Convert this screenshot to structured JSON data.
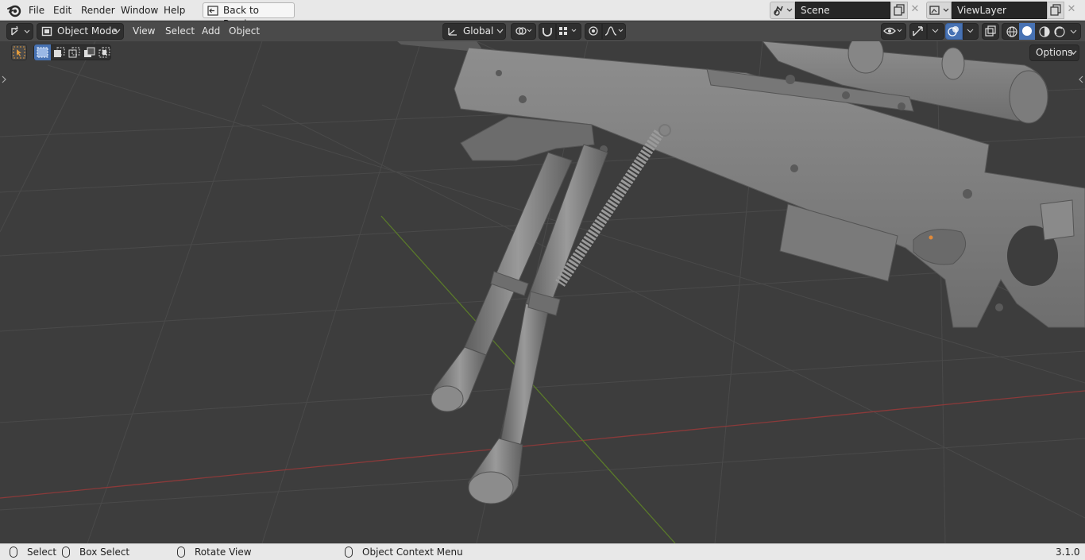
{
  "menubar": {
    "items": [
      "File",
      "Edit",
      "Render",
      "Window",
      "Help"
    ],
    "back_button": "Back to Previous",
    "scene": "Scene",
    "view_layer": "ViewLayer"
  },
  "header": {
    "mode": "Object Mode",
    "menus": [
      "View",
      "Select",
      "Add",
      "Object"
    ],
    "transform_orientation": "Global"
  },
  "viewport": {
    "options_label": "Options"
  },
  "statusbar": {
    "select": "Select",
    "box_select": "Box Select",
    "rotate_view": "Rotate View",
    "context_menu": "Object Context Menu",
    "version": "3.1.0"
  },
  "colors": {
    "topbar_bg": "#e8e8e8",
    "header_bg": "#4a4a4a",
    "viewport_bg": "#3d3d3d",
    "accent_blue": "#4772b3",
    "x_axis": "#8b3a3a",
    "y_axis": "#5a7a2a"
  }
}
